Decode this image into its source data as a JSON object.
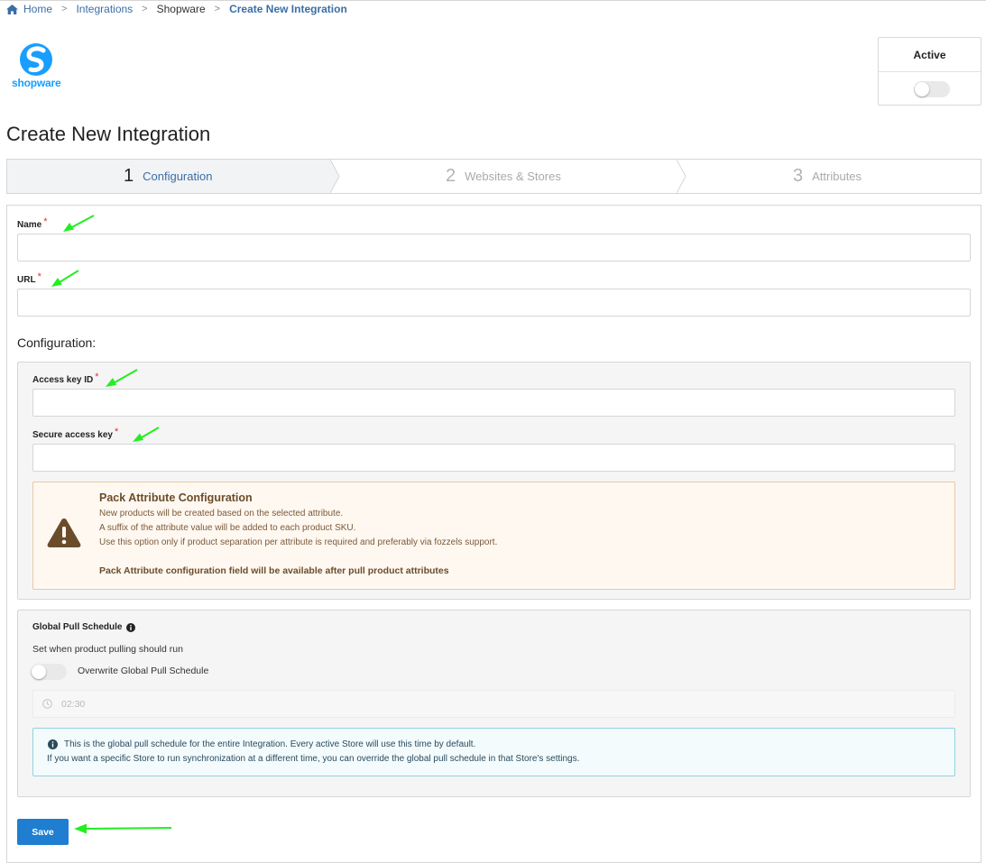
{
  "breadcrumb": {
    "items": [
      "Home",
      "Integrations",
      "Shopware",
      "Create New Integration"
    ],
    "separator": ">"
  },
  "brand": {
    "logo_text": "shopware",
    "color": "#189eff"
  },
  "active_toggle": {
    "label": "Active",
    "on": false
  },
  "page_title": "Create New Integration",
  "stepper": {
    "steps": [
      {
        "number": "1",
        "label": "Configuration",
        "current": true
      },
      {
        "number": "2",
        "label": "Websites & Stores",
        "current": false
      },
      {
        "number": "3",
        "label": "Attributes",
        "current": false
      }
    ]
  },
  "form": {
    "name": {
      "label": "Name",
      "required_mark": "*",
      "value": ""
    },
    "url": {
      "label": "URL",
      "required_mark": "*",
      "value": ""
    },
    "configuration_title": "Configuration:",
    "access_key_id": {
      "label": "Access key ID",
      "required_mark": "*",
      "value": ""
    },
    "secure_access_key": {
      "label": "Secure access key",
      "required_mark": "*",
      "value": ""
    }
  },
  "pack_notice": {
    "title": "Pack Attribute Configuration",
    "lines": [
      "New products will be created based on the selected attribute.",
      "A suffix of the attribute value will be added to each product SKU.",
      "Use this option only if product separation per attribute is required and preferably via fozzels support."
    ],
    "bold_note": "Pack Attribute configuration field will be available after pull product attributes"
  },
  "schedule": {
    "title": "Global Pull Schedule",
    "subtitle": "Set when product pulling should run",
    "overwrite_label": "Overwrite Global Pull Schedule",
    "overwrite_on": false,
    "time_value": "02:30",
    "info_lines": [
      "This is the global pull schedule for the entire Integration. Every active Store will use this time by default.",
      "If you want a specific Store to run synchronization at a different time, you can override the global pull schedule in that Store's settings."
    ]
  },
  "save_label": "Save",
  "colors": {
    "link": "#3a6ea5",
    "primary_button": "#1f7ed0",
    "required": "#d9363e",
    "annotation_arrow": "#22ee22",
    "warning_bg": "#fff8f1",
    "info_bg": "#f3fbfd"
  },
  "icons": [
    "home-icon",
    "warning-icon",
    "info-circle-icon",
    "clock-icon"
  ]
}
